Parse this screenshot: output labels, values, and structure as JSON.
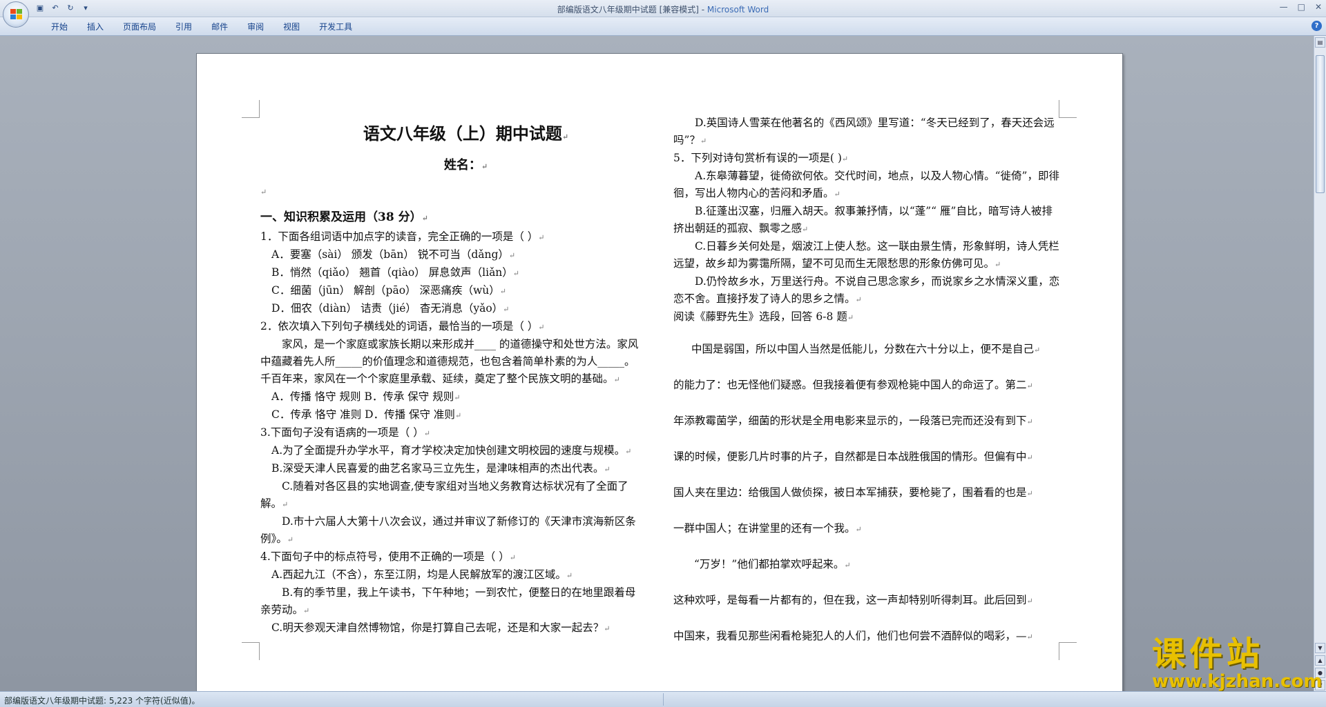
{
  "window": {
    "title": "部编版语文八年级期中试题 [兼容模式] - ",
    "app_name": "Microsoft Word",
    "controls": [
      "minimize",
      "maximize",
      "close"
    ]
  },
  "quick_access": [
    "save-icon",
    "undo-icon",
    "redo-icon",
    "customize-icon"
  ],
  "ribbon": {
    "tabs": [
      "开始",
      "插入",
      "页面布局",
      "引用",
      "邮件",
      "审阅",
      "视图",
      "开发工具"
    ]
  },
  "document": {
    "title": "语文八年级（上）期中试题",
    "name_line": "姓名：",
    "left_column": [
      {
        "cls": "section",
        "text": "一、知识积累及运用（38 分）"
      },
      {
        "cls": "",
        "text": "1．下面各组词语中加点字的读音，完全正确的一项是（ ）"
      },
      {
        "cls": "ind1",
        "text": "A．要塞（sài）   颁发（bān）   锐不可当（dǎng）"
      },
      {
        "cls": "ind1",
        "text": "B．悄然（qiǎo）  翘首（qiào）   屏息敛声（liǎn）"
      },
      {
        "cls": "ind1",
        "text": "C．细菌（jūn）   解剖（pāo）    深恶痛疾（wù）"
      },
      {
        "cls": "ind1",
        "text": "D．佃农（diàn）  诘责（jié）    杳无消息（yǎo）"
      },
      {
        "cls": "",
        "text": "2．依次填入下列句子横线处的词语，最恰当的一项是（ ）"
      },
      {
        "cls": "wrap para",
        "text": "家风，是一个家庭或家族长期以来形成并____ 的道德操守和处世方法。家风中蕴藏着先人所_____的价值理念和道德规范，也包含着简单朴素的为人_____。千百年来，家风在一个个家庭里承载、延续，奠定了整个民族文明的基础。"
      },
      {
        "cls": "ind1",
        "text": "A．传播  恪守  规则      B．传承  保守  规则"
      },
      {
        "cls": "ind1",
        "text": "C．传承  恪守  准则      D．传播  保守  准则"
      },
      {
        "cls": "",
        "text": "3.下面句子没有语病的一项是（ ）"
      },
      {
        "cls": "ind1",
        "text": "A.为了全面提升办学水平，育才学校决定加快创建文明校园的速度与规模。"
      },
      {
        "cls": "ind1",
        "text": "B.深受天津人民喜爱的曲艺名家马三立先生，是津味相声的杰出代表。"
      },
      {
        "cls": "wrap para",
        "text": "C.随着对各区县的实地调查,使专家组对当地义务教育达标状况有了全面了解。"
      },
      {
        "cls": "wrap para",
        "text": "D.市十六届人大第十八次会议，通过并审议了新修订的《天津市滨海新区条例》。"
      },
      {
        "cls": "",
        "text": "4.下面句子中的标点符号，使用不正确的一项是（ ）"
      },
      {
        "cls": "ind1",
        "text": "A.西起九江（不含），东至江阴，均是人民解放军的渡江区域。"
      },
      {
        "cls": "wrap para",
        "text": "B.有的季节里，我上午读书，下午种地；一到农忙，便整日的在地里跟着母亲劳动。"
      },
      {
        "cls": "ind1",
        "text": "C.明天参观天津自然博物馆，你是打算自己去呢，还是和大家一起去？"
      }
    ],
    "right_column": [
      {
        "cls": "wrap para",
        "text": "D.英国诗人雪莱在他著名的《西风颂》里写道：“冬天已经到了，春天还会远吗”？"
      },
      {
        "cls": "",
        "text": "5．下列对诗句赏析有误的一项是(     )"
      },
      {
        "cls": "wrap para",
        "text": "A.东皋薄暮望，徙倚欲何依。交代时间，地点，以及人物心情。“徙倚”，即徘徊，写出人物内心的苦闷和矛盾。"
      },
      {
        "cls": "wrap para",
        "text": "B.征蓬出汉塞，归雁入胡天。叙事兼抒情，以“蓬”“ 雁”自比，暗写诗人被排挤出朝廷的孤寂、飘零之感"
      },
      {
        "cls": "wrap para",
        "text": "C.日暮乡关何处是，烟波江上使人愁。这一联由景生情，形象鲜明，诗人凭栏远望，故乡却为雾霭所隔，望不可见而生无限愁思的形象仿佛可见。"
      },
      {
        "cls": "wrap para",
        "text": "D.仍怜故乡水，万里送行舟。不说自己思念家乡，而说家乡之水情深义重，恋恋不舍。直接抒发了诗人的思乡之情。"
      },
      {
        "cls": "",
        "text": "阅读《藤野先生》选段，回答 6-8 题"
      }
    ],
    "passage": [
      "中国是弱国，所以中国人当然是低能儿，分数在六十分以上，便不是自己",
      "的能力了：也无怪他们疑惑。但我接着便有参观枪毙中国人的命运了。第二",
      "年添教霉菌学，细菌的形状是全用电影来显示的，一段落已完而还没有到下",
      "课的时候，便影几片时事的片子，自然都是日本战胜俄国的情形。但偏有中",
      "国人夹在里边：给俄国人做侦探，被日本军捕获，要枪毙了，围着看的也是",
      "一群中国人；在讲堂里的还有一个我。",
      "“万岁！”他们都拍掌欢呼起来。",
      "这种欢呼，是每看一片都有的，但在我，这一声却特别听得刺耳。此后回到",
      "中国来，我看见那些闲看枪毙犯人的人们，他们也何尝不酒醉似的喝彩，—"
    ],
    "paragraph_mark": "↵"
  },
  "status_bar": {
    "text": "部编版语文八年级期中试题: 5,223 个字符(近似值)。"
  },
  "watermark": {
    "main": "课件站",
    "url": "www.kjzhan.com"
  },
  "colors": {
    "title_bar": "#dfe7f2",
    "ribbon_text": "#15428b",
    "workspace": "#9aa2ad",
    "watermark": "#e8c000"
  }
}
